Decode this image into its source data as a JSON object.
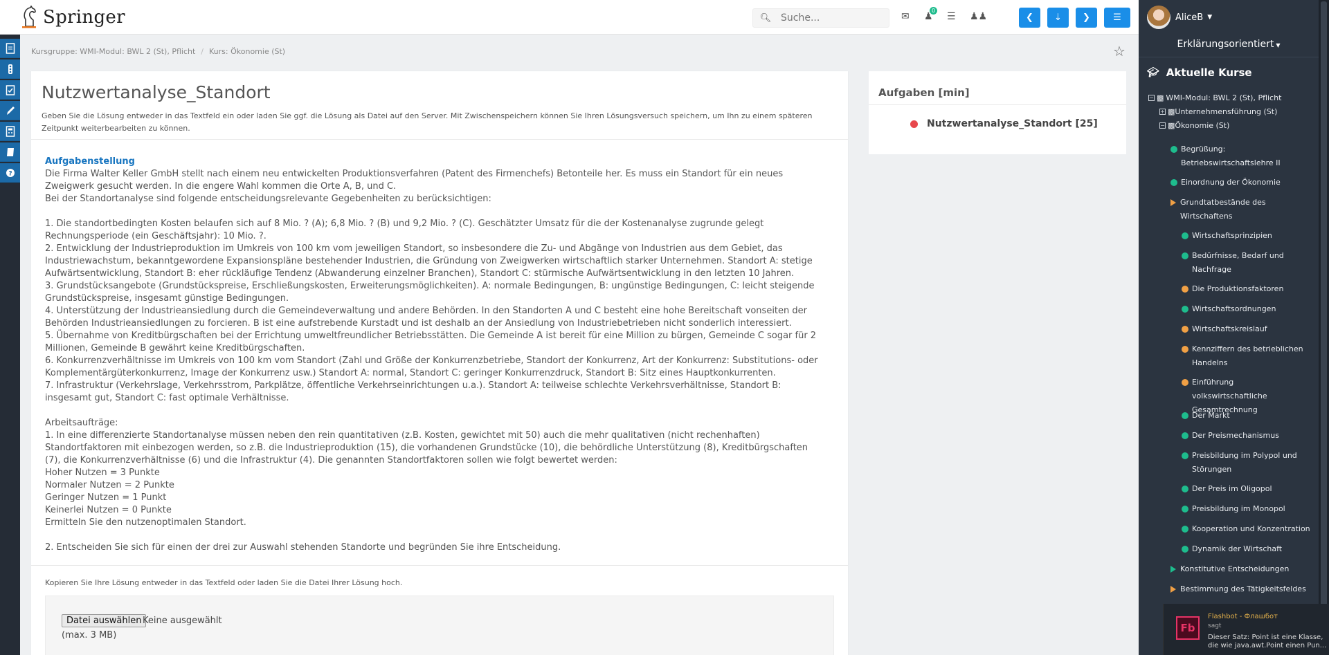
{
  "header": {
    "logo_text": "Springer",
    "search_placeholder": "Suche...",
    "badge_count": "0"
  },
  "breadcrumb": {
    "group": "Kursgruppe: WMI-Modul: BWL 2 (St), Pflicht",
    "separator": "/",
    "course": "Kurs: Ökonomie (St)"
  },
  "card": {
    "title": "Nutzwertanalyse_Standort",
    "intro": "Geben Sie die Lösung entweder in das Textfeld ein oder laden Sie ggf. die Lösung als Datei auf den Server. Mit Zwischenspeichern können Sie Ihren Lösungsversuch speichern, um Ihn zu einem späteren Zeitpunkt weiterbearbeiten zu können.",
    "task_heading": "Aufgabenstellung",
    "task_body": "Die Firma Walter Keller GmbH stellt nach einem neu entwickelten Produktionsverfahren (Patent des Firmenchefs) Betonteile her. Es muss ein Standort für ein neues\nZweigwerk gesucht werden. In die engere Wahl kommen die Orte A, B, und C.\nBei der Standortanalyse sind folgende entscheidungsrelevante Gegebenheiten zu berücksichtigen:\n\n1. Die standortbedingten Kosten belaufen sich auf 8 Mio. ? (A); 6,8 Mio. ? (B) und 9,2 Mio. ? (C). Geschätzter Umsatz für die der Kostenanalyse zugrunde gelegt\nRechnungsperiode (ein Geschäftsjahr): 10 Mio. ?.\n2. Entwicklung der Industrieproduktion im Umkreis von 100 km vom jeweiligen Standort, so insbesondere die Zu- und Abgänge von Industrien aus dem Gebiet, das\nIndustriewachstum, bekanntgewordene Expansionspläne bestehender Industrien, die Gründung von Zweigwerken wirtschaftlich starker Unternehmen. Standort A: stetige\nAufwärtsentwicklung, Standort B: eher rückläufige Tendenz (Abwanderung einzelner Branchen), Standort C: stürmische Aufwärtsentwicklung in den letzten 10 Jahren.\n3. Grundstücksangebote (Grundstückspreise, Erschließungskosten, Erweiterungsmöglichkeiten). A: normale Bedingungen, B: ungünstige Bedingungen, C: leicht steigende\nGrundstückspreise, insgesamt günstige Bedingungen.\n4. Unterstützung der Industrieansiedlung durch die Gemeindeverwaltung und andere Behörden. In den Standorten A und C besteht eine hohe Bereitschaft vonseiten der\nBehörden Industrieansiedlungen zu forcieren. B ist eine aufstrebende Kurstadt und ist deshalb an der Ansiedlung von Industriebetrieben nicht sonderlich interessiert.\n5. Übernahme von Kreditbürgschaften bei der Errichtung umweltfreundlicher Betriebsstätten. Die Gemeinde A ist bereit für eine Million zu bürgen, Gemeinde C sogar für 2\nMillionen, Gemeinde B gewährt keine Kreditbürgschaften.\n6. Konkurrenzverhältnisse im Umkreis von 100 km vom Standort (Zahl und Größe der Konkurrenzbetriebe, Standort der Konkurrenz, Art der Konkurrenz: Substitutions- oder\nKomplementärgüterkonkurrenz, Image der Konkurrenz usw.) Standort A: normal, Standort C: geringer Konkurrenzdruck, Standort B: Sitz eines Hauptkonkurrenten.\n7. Infrastruktur (Verkehrslage, Verkehrsstrom, Parkplätze, öffentliche Verkehrseinrichtungen u.a.). Standort A: teilweise schlechte Verkehrsverhältnisse, Standort B:\ninsgesamt gut, Standort C: fast optimale Verhältnisse.\n\nArbeitsaufträge:\n1. In eine differenzierte Standortanalyse müssen neben den rein quantitativen (z.B. Kosten, gewichtet mit 50) auch die mehr qualitativen (nicht rechenhaften)\nStandortfaktoren mit einbezogen werden, so z.B. die Industrieproduktion (15), die vorhandenen Grundstücke (10), die behördliche Unterstützung (8), Kreditbürgschaften\n(7), die Konkurrenzverhältnisse (6) und die Infrastruktur (4). Die genannten Standortfaktoren sollen wie folgt bewertet werden:\nHoher Nutzen = 3 Punkte\nNormaler Nutzen = 2 Punkte\nGeringer Nutzen = 1 Punkt\nKeinerlei Nutzen = 0 Punkte\nErmitteln Sie den nutzenoptimalen Standort.\n\n2. Entscheiden Sie sich für einen der drei zur Auswahl stehenden Standorte und begründen Sie ihre Entscheidung.",
    "upload_hint": "Kopieren Sie Ihre Lösung entweder in das Textfeld oder laden Sie die Datei Ihrer Lösung hoch.",
    "file_button": "Datei auswählen",
    "file_none": "Keine ausgewählt",
    "file_max": "(max. 3 MB)"
  },
  "tasks_panel": {
    "title": "Aufgaben [min]",
    "item": "Nutzwertanalyse_Standort [25]",
    "item_status_color": "#e8474c"
  },
  "sidebar": {
    "user": "AliceB",
    "mode": "Erklärungsorientiert",
    "courses_title": "Aktuelle Kurse",
    "tree": {
      "root": "WMI-Modul: BWL 2 (St), Pflicht",
      "child1": "Unternehmensführung (St)",
      "child2": "Ökonomie (St)"
    },
    "lessons": [
      {
        "label": "Begrüßung: Betriebswirtschaftslehre II",
        "status": "green"
      },
      {
        "label": "Einordnung der Ökonomie",
        "status": "green"
      },
      {
        "label": "Grundtatbestände des Wirtschaftens",
        "status": "open"
      },
      {
        "label": "Wirtschaftsprinzipien",
        "status": "green"
      },
      {
        "label": "Bedürfnisse, Bedarf und Nachfrage",
        "status": "green"
      },
      {
        "label": "Die Produktionsfaktoren",
        "status": "orange"
      },
      {
        "label": "Wirtschaftsordnungen",
        "status": "green"
      },
      {
        "label": "Wirtschaftskreislauf",
        "status": "orange"
      },
      {
        "label": "Kennziffern des betrieblichen Handelns",
        "status": "orange"
      },
      {
        "label": "Einführung volkswirtschaftliche Gesamtrechnung",
        "status": "orange"
      },
      {
        "label": "Der Markt",
        "status": "green"
      },
      {
        "label": "Der Preismechanismus",
        "status": "green"
      },
      {
        "label": "Preisbildung im Polypol und Störungen",
        "status": "green"
      },
      {
        "label": "Der Preis im Oligopol",
        "status": "green"
      },
      {
        "label": "Preisbildung im Monopol",
        "status": "green"
      },
      {
        "label": "Kooperation und Konzentration",
        "status": "green"
      },
      {
        "label": "Dynamik der Wirtschaft",
        "status": "green"
      },
      {
        "label": "Konstitutive Entscheidungen",
        "status": "closed-green"
      },
      {
        "label": "Bestimmung des Tätigkeitsfeldes",
        "status": "closed"
      }
    ],
    "colors": {
      "green": "#1ebc8d",
      "orange": "#f0a045"
    }
  },
  "toast": {
    "who": "Flashbot - Флашбот",
    "says": "sagt",
    "message": "Dieser Satz: Point ist eine Klasse, die wie java.awt.Point einen Pun...",
    "logo": "Fb"
  }
}
